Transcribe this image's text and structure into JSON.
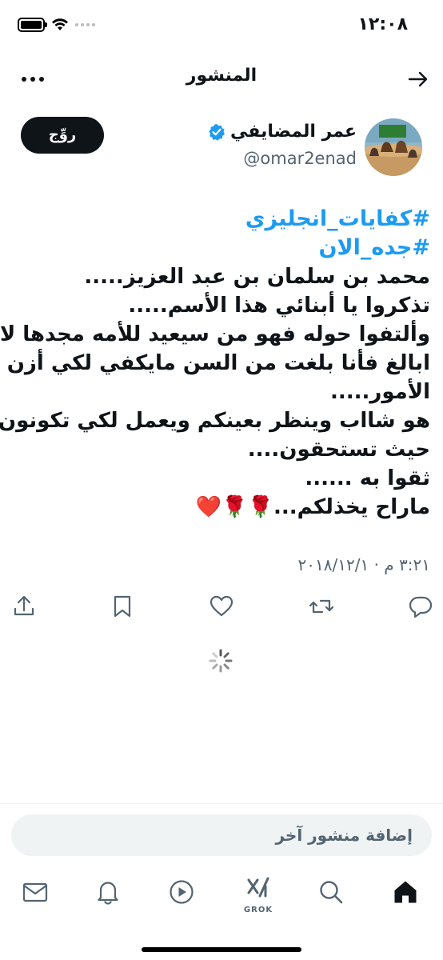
{
  "status_bar": {
    "time": "١٢:٠٨"
  },
  "header": {
    "title": "المنشور",
    "back_icon": "arrow-right-icon",
    "more_icon": "more-horizontal-icon"
  },
  "author": {
    "name": "عمر المضايفي",
    "handle": "@omar2enad",
    "verified": true,
    "follow_label": "روِّج"
  },
  "post": {
    "hashtags": [
      "#كفايات_انجليزي",
      "#جده_الان"
    ],
    "lines": [
      "محمد بن سلمان بن عبد العزيز.....",
      "تذكروا يا أبنائي هذا الأسم.....",
      "وألتفوا حوله  فهو من سيعيد للأمه مجدها لا",
      "ابالغ  فأنا بلغت من السن مايكفي لكي أزن",
      "الأمور.....",
      "هو شااب وينظر بعينكم ويعمل لكي تكونون",
      "حيث تستحقون....",
      "ثقوا به ......",
      "ماراح يخذلكم...🌹🌹❤️"
    ],
    "timestamp": "٣:٢١ م · ٢٠١٨/١٢/١"
  },
  "actions": [
    "reply-icon",
    "repost-icon",
    "like-icon",
    "bookmark-icon",
    "share-icon"
  ],
  "reply": {
    "placeholder": "إضافة منشور آخر"
  },
  "nav": {
    "grok_label": "GROK"
  },
  "colors": {
    "accent": "#1d9bf0",
    "text": "#0f1419",
    "muted": "#536471"
  }
}
